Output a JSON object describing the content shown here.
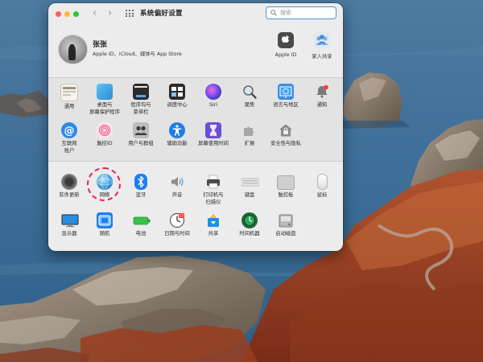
{
  "window": {
    "title": "系统偏好设置",
    "search_placeholder": "搜索"
  },
  "account": {
    "name": "张张",
    "subtitle": "Apple ID、iCloud、媒体与 App Store",
    "apple_id_label": "Apple ID",
    "family_label": "家人共享"
  },
  "panes_row1": [
    {
      "label": "通用",
      "icon": "general-icon"
    },
    {
      "label": "桌面与\n屏幕保护程序",
      "icon": "desktop-screensaver-icon"
    },
    {
      "label": "程序坞与\n菜单栏",
      "icon": "dock-menubar-icon"
    },
    {
      "label": "调度中心",
      "icon": "mission-control-icon"
    },
    {
      "label": "Siri",
      "icon": "siri-icon"
    },
    {
      "label": "聚焦",
      "icon": "spotlight-icon"
    },
    {
      "label": "语言与地区",
      "icon": "language-region-icon"
    },
    {
      "label": "通知",
      "icon": "notifications-icon"
    }
  ],
  "panes_row2": [
    {
      "label": "互联网\n账户",
      "icon": "internet-accounts-icon"
    },
    {
      "label": "触控ID",
      "icon": "touch-id-icon"
    },
    {
      "label": "用户与群组",
      "icon": "users-groups-icon"
    },
    {
      "label": "辅助功能",
      "icon": "accessibility-icon"
    },
    {
      "label": "屏幕使用时间",
      "icon": "screen-time-icon"
    },
    {
      "label": "扩展",
      "icon": "extensions-icon"
    },
    {
      "label": "安全性与隐私",
      "icon": "security-privacy-icon"
    }
  ],
  "panes_row3": [
    {
      "label": "软件更新",
      "icon": "software-update-icon"
    },
    {
      "label": "网络",
      "icon": "network-icon"
    },
    {
      "label": "蓝牙",
      "icon": "bluetooth-icon"
    },
    {
      "label": "声音",
      "icon": "sound-icon"
    },
    {
      "label": "打印机与\n扫描仪",
      "icon": "printers-scanners-icon"
    },
    {
      "label": "键盘",
      "icon": "keyboard-icon"
    },
    {
      "label": "触控板",
      "icon": "trackpad-icon"
    },
    {
      "label": "鼠标",
      "icon": "mouse-icon"
    }
  ],
  "panes_row4": [
    {
      "label": "显示器",
      "icon": "displays-icon"
    },
    {
      "label": "随航",
      "icon": "sidecar-icon"
    },
    {
      "label": "电池",
      "icon": "battery-icon"
    },
    {
      "label": "日期与时间",
      "icon": "date-time-icon"
    },
    {
      "label": "共享",
      "icon": "sharing-icon"
    },
    {
      "label": "时间机器",
      "icon": "time-machine-icon"
    },
    {
      "label": "启动磁盘",
      "icon": "startup-disk-icon"
    }
  ],
  "highlight": {
    "pane": "网络",
    "color": "#e0245e"
  }
}
